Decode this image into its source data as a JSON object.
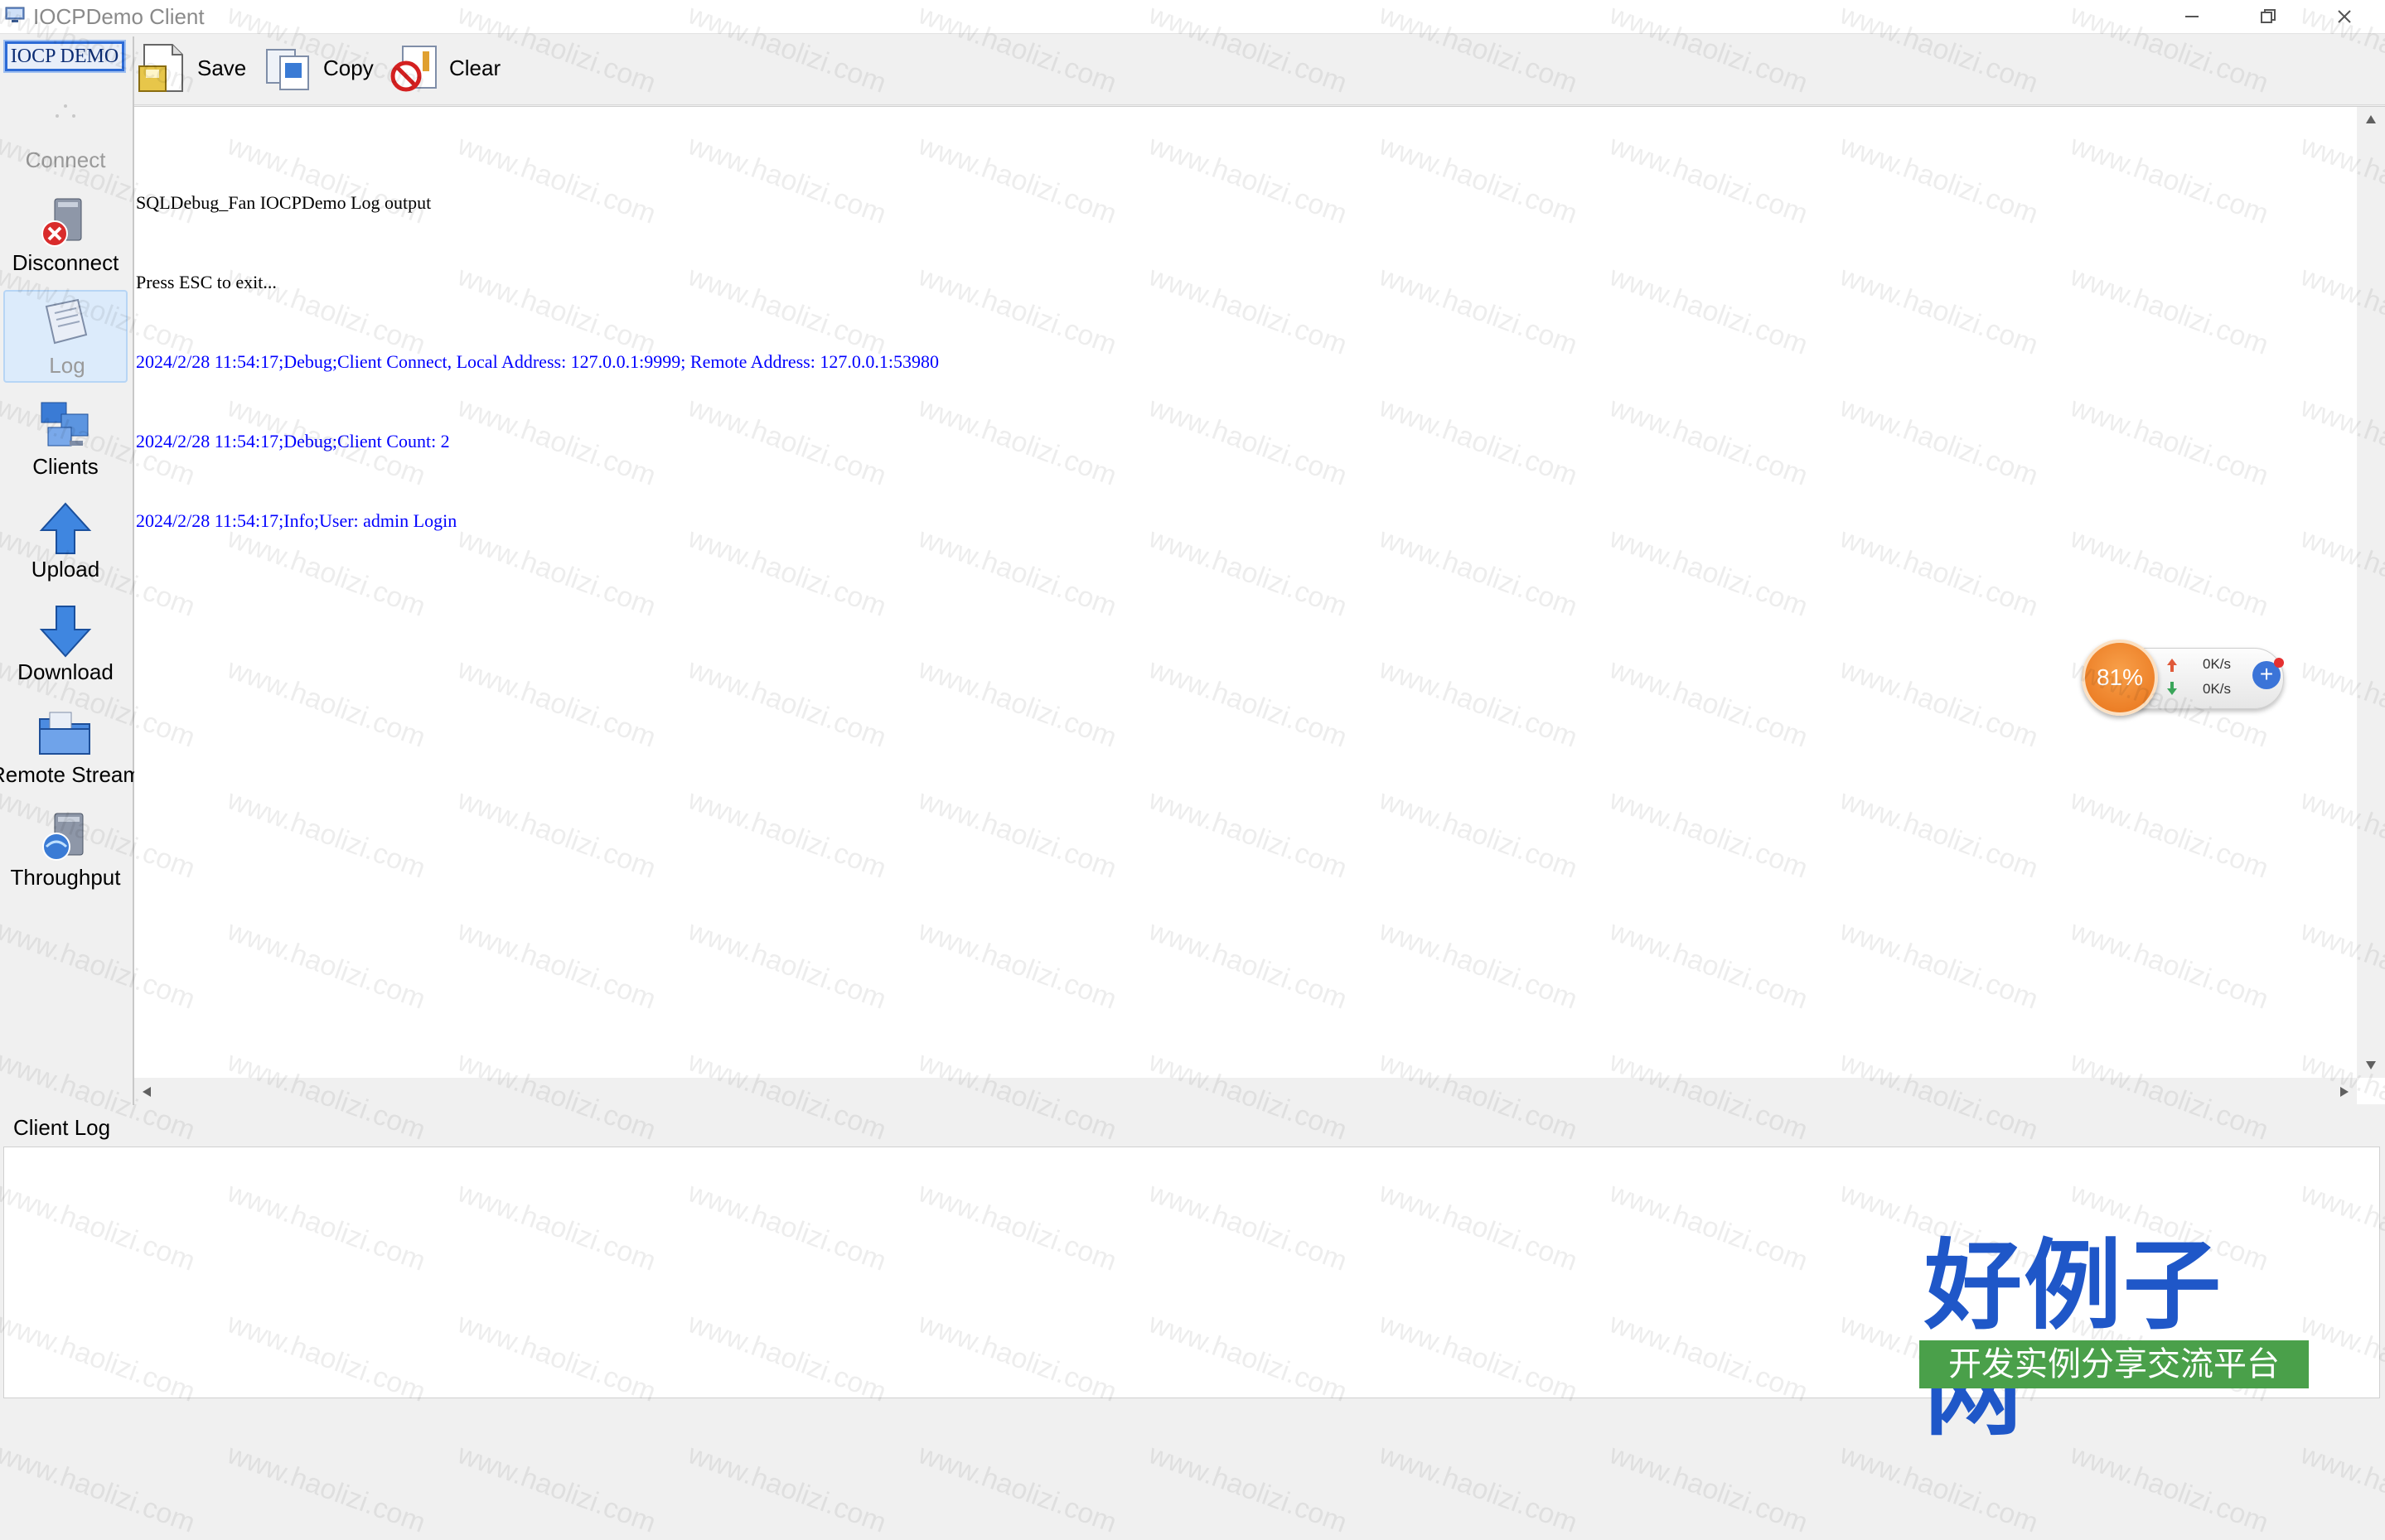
{
  "window": {
    "title": "IOCPDemo Client"
  },
  "sidebar": {
    "header": "IOCP DEMO",
    "items": [
      {
        "label": "Connect",
        "icon": "connect-icon",
        "state": "disabled"
      },
      {
        "label": "Disconnect",
        "icon": "disconnect-icon",
        "state": "normal"
      },
      {
        "label": "Log",
        "icon": "log-icon",
        "state": "selected"
      },
      {
        "label": "Clients",
        "icon": "clients-icon",
        "state": "normal"
      },
      {
        "label": "Upload",
        "icon": "upload-arrow-icon",
        "state": "normal"
      },
      {
        "label": "Download",
        "icon": "download-arrow-icon",
        "state": "normal"
      },
      {
        "label": "Remote Stream",
        "icon": "remote-stream-icon",
        "state": "normal"
      },
      {
        "label": "Throughput",
        "icon": "throughput-icon",
        "state": "normal"
      }
    ]
  },
  "toolbar": {
    "save_label": "Save",
    "copy_label": "Copy",
    "clear_label": "Clear"
  },
  "log": {
    "lines": [
      {
        "text": "SQLDebug_Fan IOCPDemo Log output",
        "kind": "info"
      },
      {
        "text": "Press ESC to exit...",
        "kind": "info"
      },
      {
        "text": "2024/2/28 11:54:17;Debug;Client Connect, Local Address: 127.0.0.1:9999; Remote Address: 127.0.0.1:53980",
        "kind": "debug"
      },
      {
        "text": "2024/2/28 11:54:17;Debug;Client Count: 2",
        "kind": "debug"
      },
      {
        "text": "2024/2/28 11:54:17;Info;User: admin Login",
        "kind": "debug"
      }
    ]
  },
  "client_log": {
    "title": "Client Log"
  },
  "net_widget": {
    "percent": "81%",
    "upload": "0K/s",
    "download": "0K/s"
  },
  "watermark": {
    "text": "www.haolizi.com"
  },
  "brand": {
    "title": "好例子网",
    "subtitle": "开发实例分享交流平台"
  },
  "colors": {
    "debug_text": "#0000ff",
    "info_text": "#000000",
    "accent": "#2d6bd6"
  }
}
